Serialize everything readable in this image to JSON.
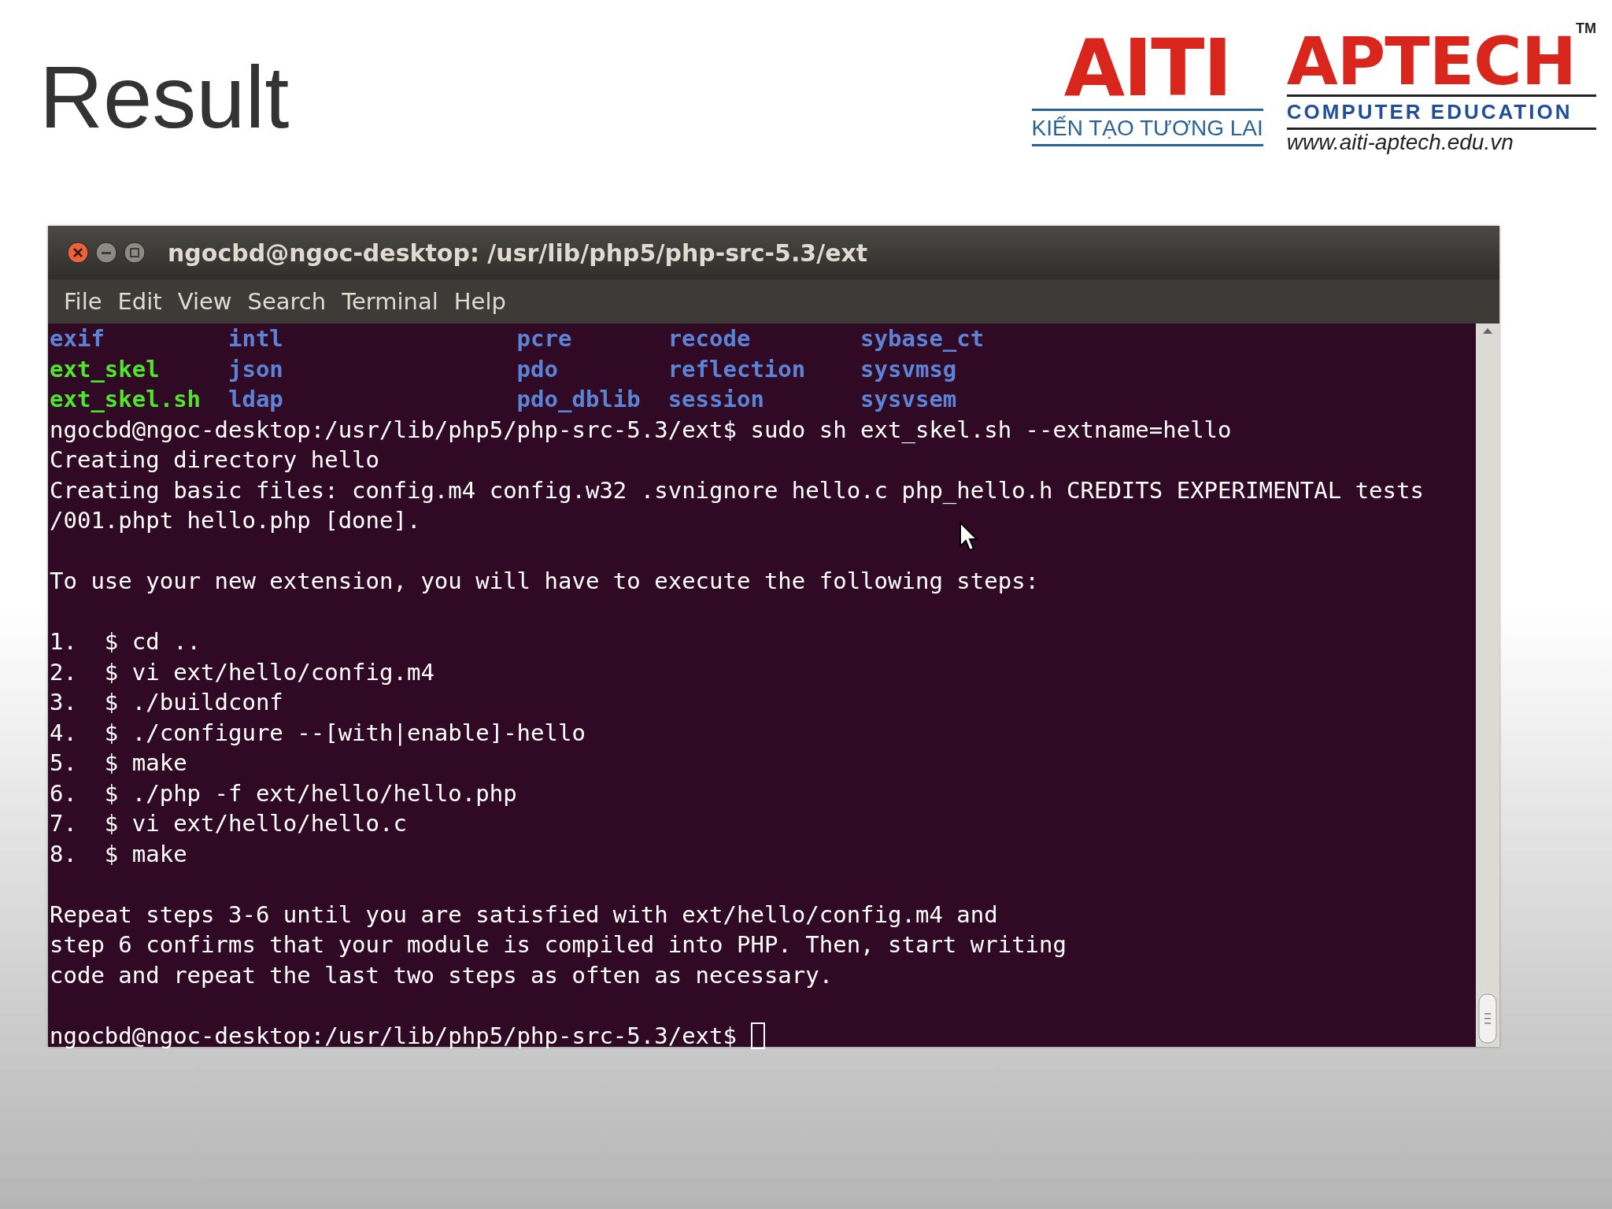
{
  "slide": {
    "title": "Result"
  },
  "logo": {
    "brand": "AITI",
    "tagline": "KIẾN TẠO TƯƠNG LAI",
    "name": "APTECH",
    "trademark": "TM",
    "subtitle": "COMPUTER EDUCATION",
    "url": "www.aiti-aptech.edu.vn"
  },
  "terminal": {
    "title": "ngocbd@ngoc-desktop: /usr/lib/php5/php-src-5.3/ext",
    "menu": [
      "File",
      "Edit",
      "View",
      "Search",
      "Terminal",
      "Help"
    ],
    "listing": [
      [
        {
          "text": "exif",
          "kind": "directory"
        },
        {
          "text": "intl",
          "kind": "directory"
        },
        {
          "text": "pcre",
          "kind": "directory"
        },
        {
          "text": "recode",
          "kind": "directory"
        },
        {
          "text": "sybase_ct",
          "kind": "directory"
        }
      ],
      [
        {
          "text": "ext_skel",
          "kind": "executable"
        },
        {
          "text": "json",
          "kind": "directory"
        },
        {
          "text": "pdo",
          "kind": "directory"
        },
        {
          "text": "reflection",
          "kind": "directory"
        },
        {
          "text": "sysvmsg",
          "kind": "directory"
        }
      ],
      [
        {
          "text": "ext_skel.sh",
          "kind": "executable"
        },
        {
          "text": "ldap",
          "kind": "directory"
        },
        {
          "text": "pdo_dblib",
          "kind": "directory"
        },
        {
          "text": "session",
          "kind": "directory"
        },
        {
          "text": "sysvsem",
          "kind": "directory"
        }
      ]
    ],
    "blocks": [
      [
        "ngocbd@ngoc-desktop:/usr/lib/php5/php-src-5.3/ext$ sudo sh ext_skel.sh --extname=hello",
        "Creating directory hello",
        "Creating basic files: config.m4 config.w32 .svnignore hello.c php_hello.h CREDITS EXPERIMENTAL tests",
        "/001.phpt hello.php [done]."
      ],
      [
        "To use your new extension, you will have to execute the following steps:"
      ],
      [
        "1.  $ cd ..",
        "2.  $ vi ext/hello/config.m4",
        "3.  $ ./buildconf",
        "4.  $ ./configure --[with|enable]-hello",
        "5.  $ make",
        "6.  $ ./php -f ext/hello/hello.php",
        "7.  $ vi ext/hello/hello.c",
        "8.  $ make"
      ],
      [
        "Repeat steps 3-6 until you are satisfied with ext/hello/config.m4 and",
        "step 6 confirms that your module is compiled into PHP. Then, start writing",
        "code and repeat the last two steps as often as necessary."
      ]
    ],
    "prompt": "ngocbd@ngoc-desktop:/usr/lib/php5/php-src-5.3/ext$"
  }
}
